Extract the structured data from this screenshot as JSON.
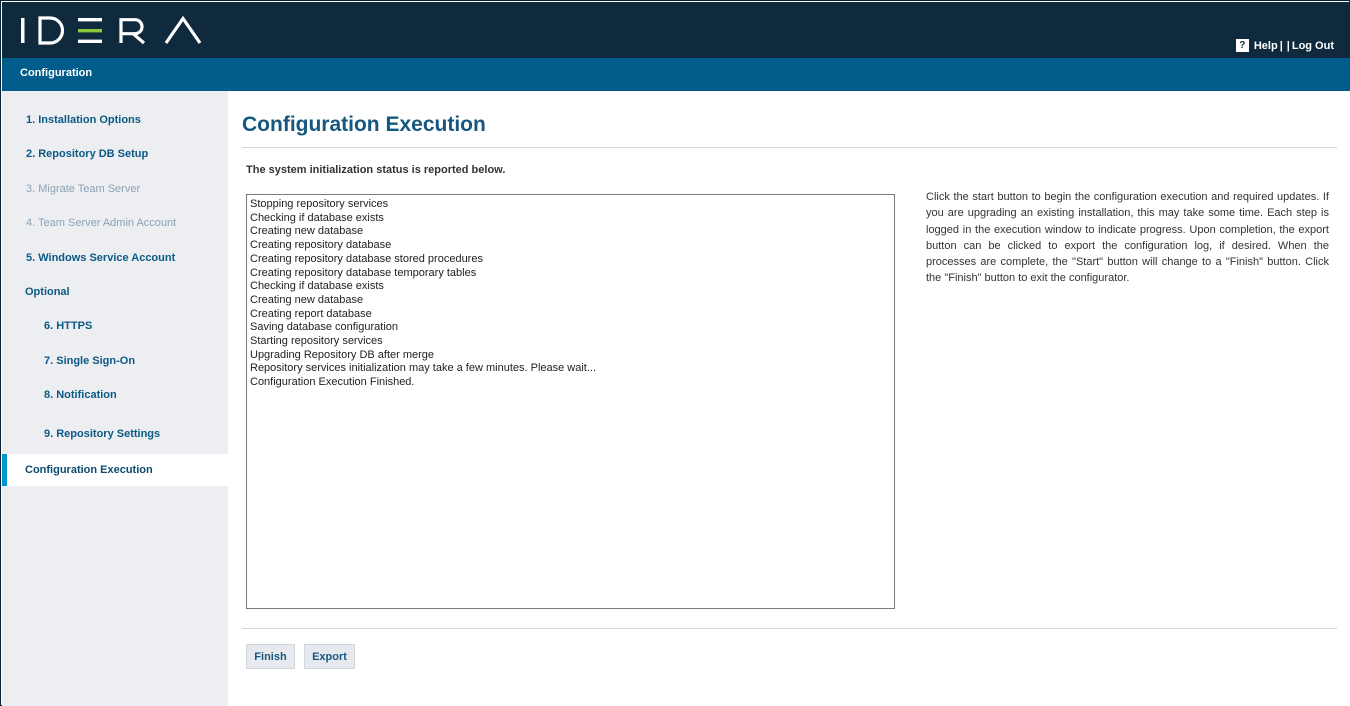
{
  "header": {
    "logo_text": "IDERA",
    "help_label": "Help",
    "separator": "|",
    "logout_label": "Log Out",
    "help_icon_glyph": "?"
  },
  "subheader": {
    "title": "Configuration"
  },
  "sidebar": {
    "items": [
      {
        "label": "1. Installation Options",
        "state": "enabled"
      },
      {
        "label": "2. Repository DB Setup",
        "state": "enabled"
      },
      {
        "label": "3. Migrate Team Server",
        "state": "disabled"
      },
      {
        "label": "4. Team Server Admin Account",
        "state": "disabled"
      },
      {
        "label": "5. Windows Service Account",
        "state": "enabled"
      },
      {
        "label": "Optional",
        "state": "section"
      },
      {
        "label": "6. HTTPS",
        "state": "enabled"
      },
      {
        "label": "7. Single Sign-On",
        "state": "enabled"
      },
      {
        "label": "8. Notification",
        "state": "enabled"
      },
      {
        "label": "9. Repository Settings",
        "state": "enabled"
      },
      {
        "label": "Configuration Execution",
        "state": "active"
      }
    ]
  },
  "main": {
    "title": "Configuration Execution",
    "subtitle": "The system initialization status is reported below.",
    "log_lines": [
      "Stopping repository services",
      "Checking if database exists",
      "Creating new database",
      "Creating repository database",
      "Creating repository database stored procedures",
      "Creating repository database temporary tables",
      "Checking if database exists",
      "Creating new database",
      "Creating report database",
      "Saving database configuration",
      "Starting repository services",
      "Upgrading Repository DB after merge",
      "Repository services initialization may take a few minutes. Please wait...",
      "Configuration Execution Finished."
    ],
    "help_text": "Click the start button to begin the configuration execution and required updates. If you are upgrading an existing installation, this may take some time. Each step is logged in the execution window to indicate progress. Upon completion, the export button can be clicked to export the configuration log, if desired. When the processes are complete, the \"Start\" button will change to a \"Finish\" button. Click the \"Finish\" button to exit the configurator.",
    "finish_label": "Finish",
    "export_label": "Export"
  },
  "colors": {
    "header_bg": "#0f2a3d",
    "subheader_bg": "#005c8a",
    "logo_accent": "#8dc63f",
    "active_indicator": "#0097cf"
  }
}
